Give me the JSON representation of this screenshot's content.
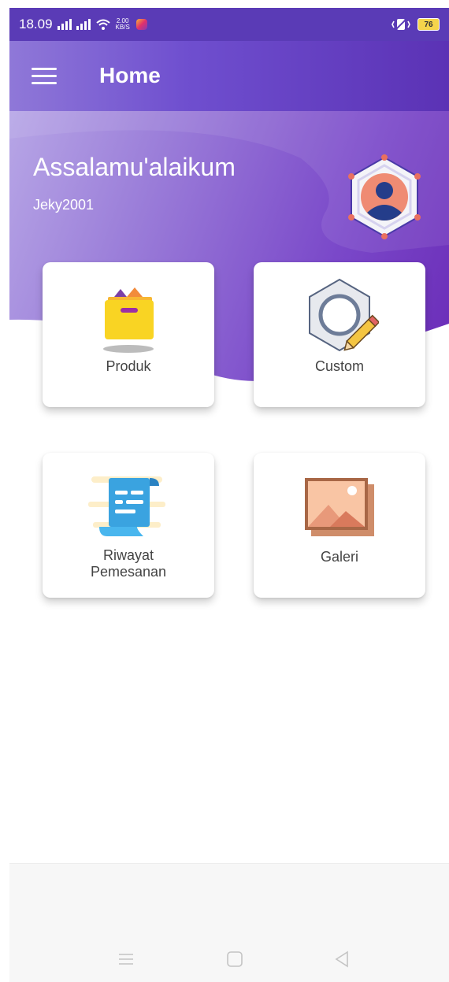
{
  "status_bar": {
    "time": "18.09",
    "net_speed_top": "2.00",
    "net_speed_bottom": "KB/S",
    "battery": "76"
  },
  "header": {
    "title": "Home"
  },
  "greeting": {
    "title": "Assalamu'alaikum",
    "username": "Jeky2001"
  },
  "menu": [
    {
      "label": "Produk",
      "icon": "folder-box-icon"
    },
    {
      "label": "Custom",
      "icon": "custom-edit-icon"
    },
    {
      "label_line1": "Riwayat",
      "label_line2": "Pemesanan",
      "icon": "scroll-list-icon"
    },
    {
      "label": "Galeri",
      "icon": "gallery-image-icon"
    }
  ],
  "colors": {
    "primary": "#6f4fcf",
    "accent": "#5b32b5",
    "card_bg": "#ffffff"
  }
}
